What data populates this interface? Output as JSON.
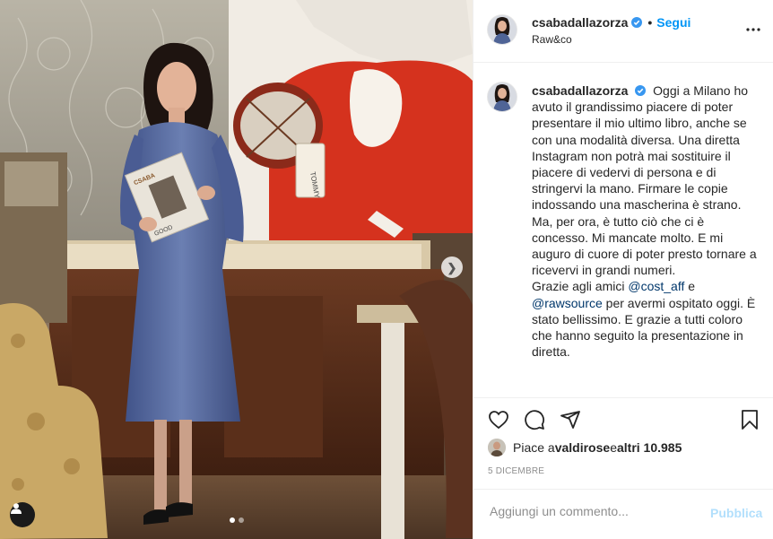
{
  "post": {
    "username": "csabadallazorza",
    "verified": true,
    "follow_label": "Segui",
    "separator": "•",
    "location": "Raw&co",
    "more_icon": "more-horizontal-icon"
  },
  "photo": {
    "description_icon": "photo",
    "slide_count": 2,
    "active_slide": 1,
    "next_icon": "chevron-right-icon",
    "tag_icon": "user-tag-icon",
    "book_title": "CSABA",
    "book_subtitle": "GOOD",
    "tag_text": "TOMMY"
  },
  "caption": {
    "username": "csabadallazorza",
    "text_1": "Oggi a Milano ho avuto il grandissimo piacere di poter presentare il mio ultimo libro, anche se con una modalità diversa. Una diretta Instagram non potrà mai sostituire il piacere di vedervi di persona e di stringervi la mano. Firmare le copie indossando una mascherina è strano. Ma, per ora, è tutto ciò che ci è concesso. Mi mancate molto. E mi auguro di cuore di poter presto tornare a ricevervi in grandi numeri.",
    "text_2_prefix": "Grazie agli amici ",
    "mention_1": "@cost_aff",
    "text_2_mid": " e",
    "mention_2": "@rawsource",
    "text_2_suffix": " per avermi ospitato oggi. È stato bellissimo. E grazie a tutti coloro che hanno seguito la presentazione in diretta."
  },
  "actions": {
    "like_icon": "heart-icon",
    "comment_icon": "comment-icon",
    "share_icon": "share-icon",
    "save_icon": "bookmark-icon"
  },
  "likes": {
    "prefix": "Piace a ",
    "user": "valdirose",
    "middle": " e ",
    "others": "altri 10.985"
  },
  "date": "5 DICEMBRE",
  "comment": {
    "placeholder": "Aggiungi un commento...",
    "publish_label": "Pubblica"
  },
  "colors": {
    "link": "#0095f6",
    "mention": "#00376b",
    "publish_disabled": "#b2dffc",
    "muted": "#8e8e8e",
    "dress": "#4f6496"
  }
}
